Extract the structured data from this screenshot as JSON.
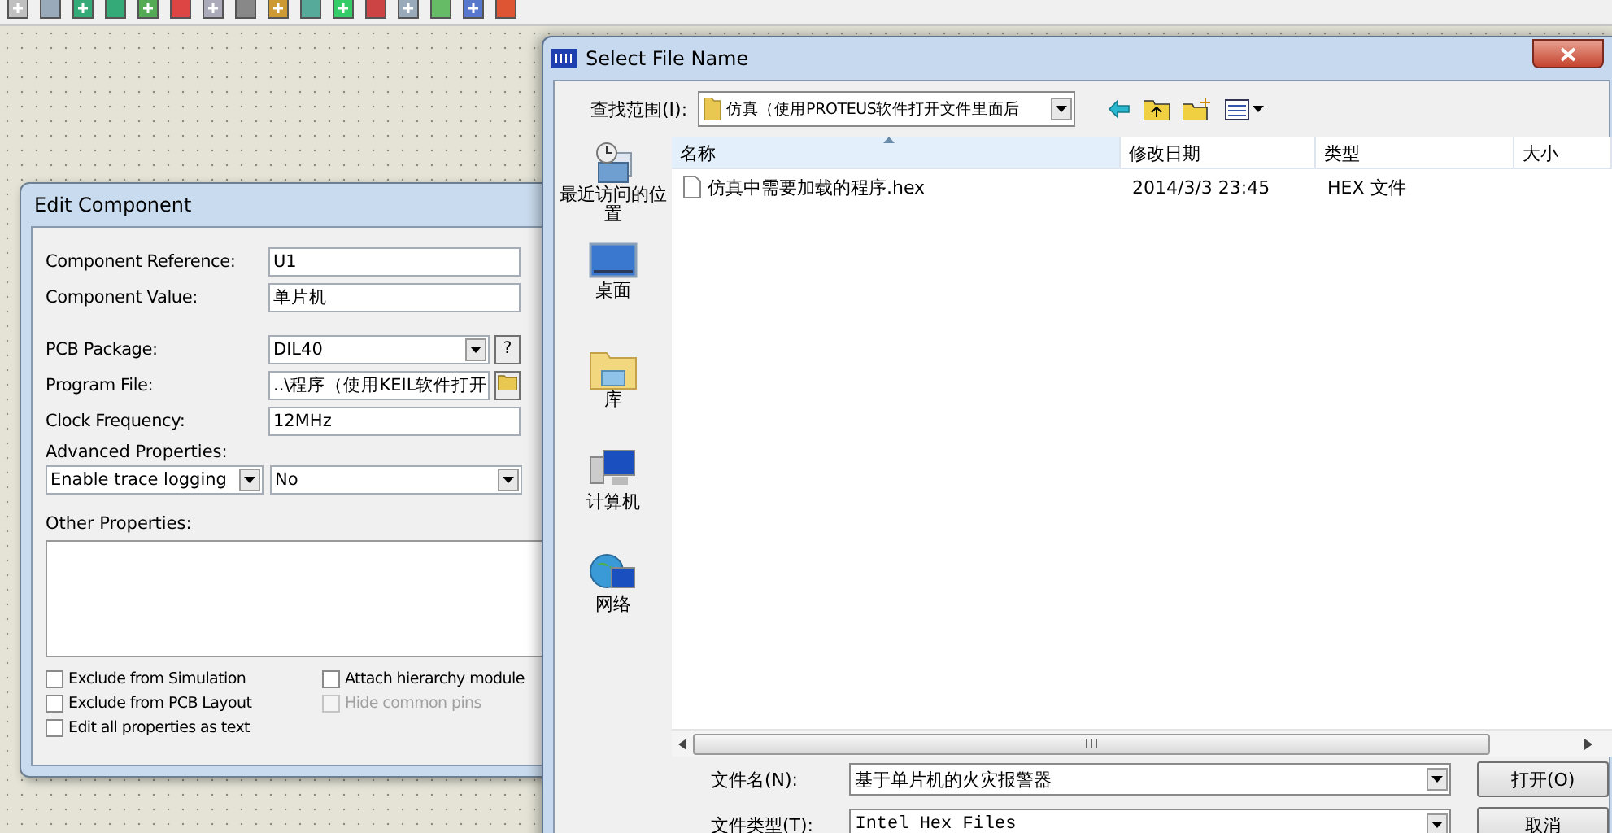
{
  "edit_component": {
    "title": "Edit Component",
    "fields": [
      {
        "label": "Component Reference:",
        "value": "U1",
        "kind": "text"
      },
      {
        "label": "Component Value:",
        "value": "单片机",
        "kind": "text"
      },
      {
        "label": "PCB Package:",
        "value": "DIL40",
        "kind": "combo",
        "help": "?"
      },
      {
        "label": "Program File:",
        "value": "..\\程序（使用KEIL软件打开",
        "kind": "file"
      },
      {
        "label": "Clock Frequency:",
        "value": "12MHz",
        "kind": "text"
      }
    ],
    "advanced_properties": {
      "label": "Advanced Properties:",
      "property": "Enable trace logging",
      "value": "No"
    },
    "other_properties": {
      "label": "Other Properties:"
    },
    "checkboxes": [
      {
        "label": "Exclude from Simulation",
        "checked": false,
        "disabled": false
      },
      {
        "label": "Exclude from PCB Layout",
        "checked": false,
        "disabled": false
      },
      {
        "label": "Edit all properties as text",
        "checked": false,
        "disabled": false
      },
      {
        "label": "Attach hierarchy module",
        "checked": false,
        "disabled": false
      },
      {
        "label": "Hide common pins",
        "checked": false,
        "disabled": true
      }
    ]
  },
  "file_dialog": {
    "title": "Select File Name",
    "look_in_label": "查找范围(I):",
    "look_in_value": "仿真（使用PROTEUS软件打开文件里面后",
    "places": [
      {
        "label": "最近访问的位置",
        "kind": "recent"
      },
      {
        "label": "桌面",
        "kind": "desktop"
      },
      {
        "label": "库",
        "kind": "library"
      },
      {
        "label": "计算机",
        "kind": "computer"
      },
      {
        "label": "网络",
        "kind": "network"
      }
    ],
    "columns": [
      {
        "label": "名称",
        "sorted": true
      },
      {
        "label": "修改日期",
        "sorted": false
      },
      {
        "label": "类型",
        "sorted": false
      },
      {
        "label": "大小",
        "sorted": false
      }
    ],
    "rows": [
      {
        "name": "仿真中需要加载的程序.hex",
        "modified": "2014/3/3 23:45",
        "type": "HEX 文件",
        "size": ""
      }
    ],
    "file_name_label": "文件名(N):",
    "file_name_value": "基于单片机的火灾报警器",
    "file_type_label": "文件类型(T):",
    "file_type_value": "Intel Hex Files",
    "buttons": [
      "打开(O)",
      "取消"
    ]
  }
}
